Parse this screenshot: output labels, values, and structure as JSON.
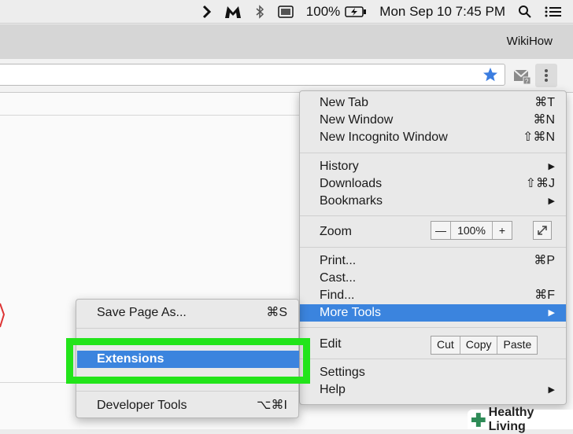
{
  "menubar": {
    "battery": "100%",
    "datetime": "Mon Sep 10  7:45 PM"
  },
  "browser": {
    "profile_name": "WikiHow"
  },
  "main_menu": {
    "new_tab": {
      "label": "New Tab",
      "shortcut": "⌘T"
    },
    "new_window": {
      "label": "New Window",
      "shortcut": "⌘N"
    },
    "new_incognito": {
      "label": "New Incognito Window",
      "shortcut": "⇧⌘N"
    },
    "history": {
      "label": "History"
    },
    "downloads": {
      "label": "Downloads",
      "shortcut": "⇧⌘J"
    },
    "bookmarks": {
      "label": "Bookmarks"
    },
    "zoom": {
      "label": "Zoom",
      "minus": "—",
      "value": "100%",
      "plus": "+"
    },
    "print": {
      "label": "Print...",
      "shortcut": "⌘P"
    },
    "cast": {
      "label": "Cast..."
    },
    "find": {
      "label": "Find...",
      "shortcut": "⌘F"
    },
    "more_tools": {
      "label": "More Tools"
    },
    "edit": {
      "label": "Edit",
      "cut": "Cut",
      "copy": "Copy",
      "paste": "Paste"
    },
    "settings": {
      "label": "Settings"
    },
    "help": {
      "label": "Help"
    }
  },
  "sub_menu": {
    "save_page": {
      "label": "Save Page As...",
      "shortcut": "⌘S"
    },
    "extensions": {
      "label": "Extensions"
    },
    "developer_tools": {
      "label": "Developer Tools",
      "shortcut": "⌥⌘I"
    }
  },
  "watermark": {
    "text": "Healthy Living"
  }
}
